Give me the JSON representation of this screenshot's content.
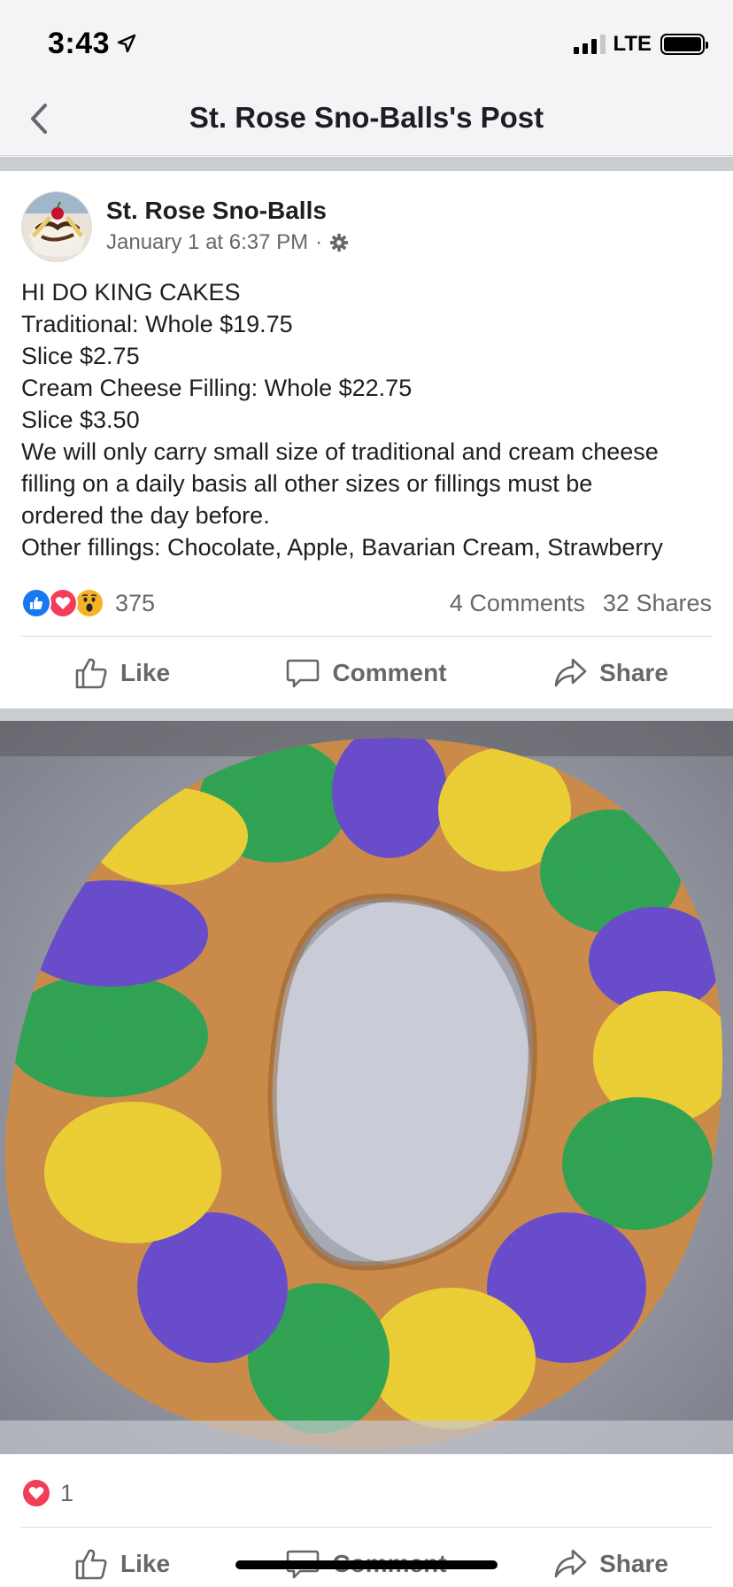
{
  "status_bar": {
    "time": "3:43",
    "network": "LTE",
    "icons": [
      "location-arrow-icon",
      "signal-bars-icon",
      "battery-icon"
    ]
  },
  "nav": {
    "title": "St. Rose Sno-Balls's Post",
    "back_icon": "chevron-left-icon"
  },
  "post": {
    "author": "St. Rose Sno-Balls",
    "timestamp": "January 1 at 6:37 PM",
    "separator": "·",
    "privacy_icon": "gear-icon",
    "lines": [
      "HI DO KING CAKES",
      "Traditional: Whole $19.75",
      "Slice $2.75",
      "Cream Cheese Filling: Whole $22.75",
      "Slice $3.50",
      "We will only carry small size of traditional and cream cheese",
      "filling on a daily basis all other sizes or fillings must be",
      "ordered the day before.",
      "Other fillings: Chocolate, Apple, Bavarian Cream, Strawberry"
    ],
    "reaction_count": "375",
    "reaction_icons": [
      "like-icon",
      "love-icon",
      "wow-icon"
    ],
    "comments": "4 Comments",
    "shares": "32 Shares"
  },
  "actions": {
    "like": "Like",
    "comment": "Comment",
    "share": "Share"
  },
  "photo": {
    "reaction_count": "1",
    "reaction_icons": [
      "love-icon"
    ]
  },
  "colors": {
    "facebook_blue": "#1877f2",
    "love_red": "#f33e58",
    "wow_yellow": "#f7b125",
    "secondary_text": "#65676b",
    "purple_sugar": "#6c4fd0",
    "green_sugar": "#32a856",
    "gold_sugar": "#f2d438"
  }
}
